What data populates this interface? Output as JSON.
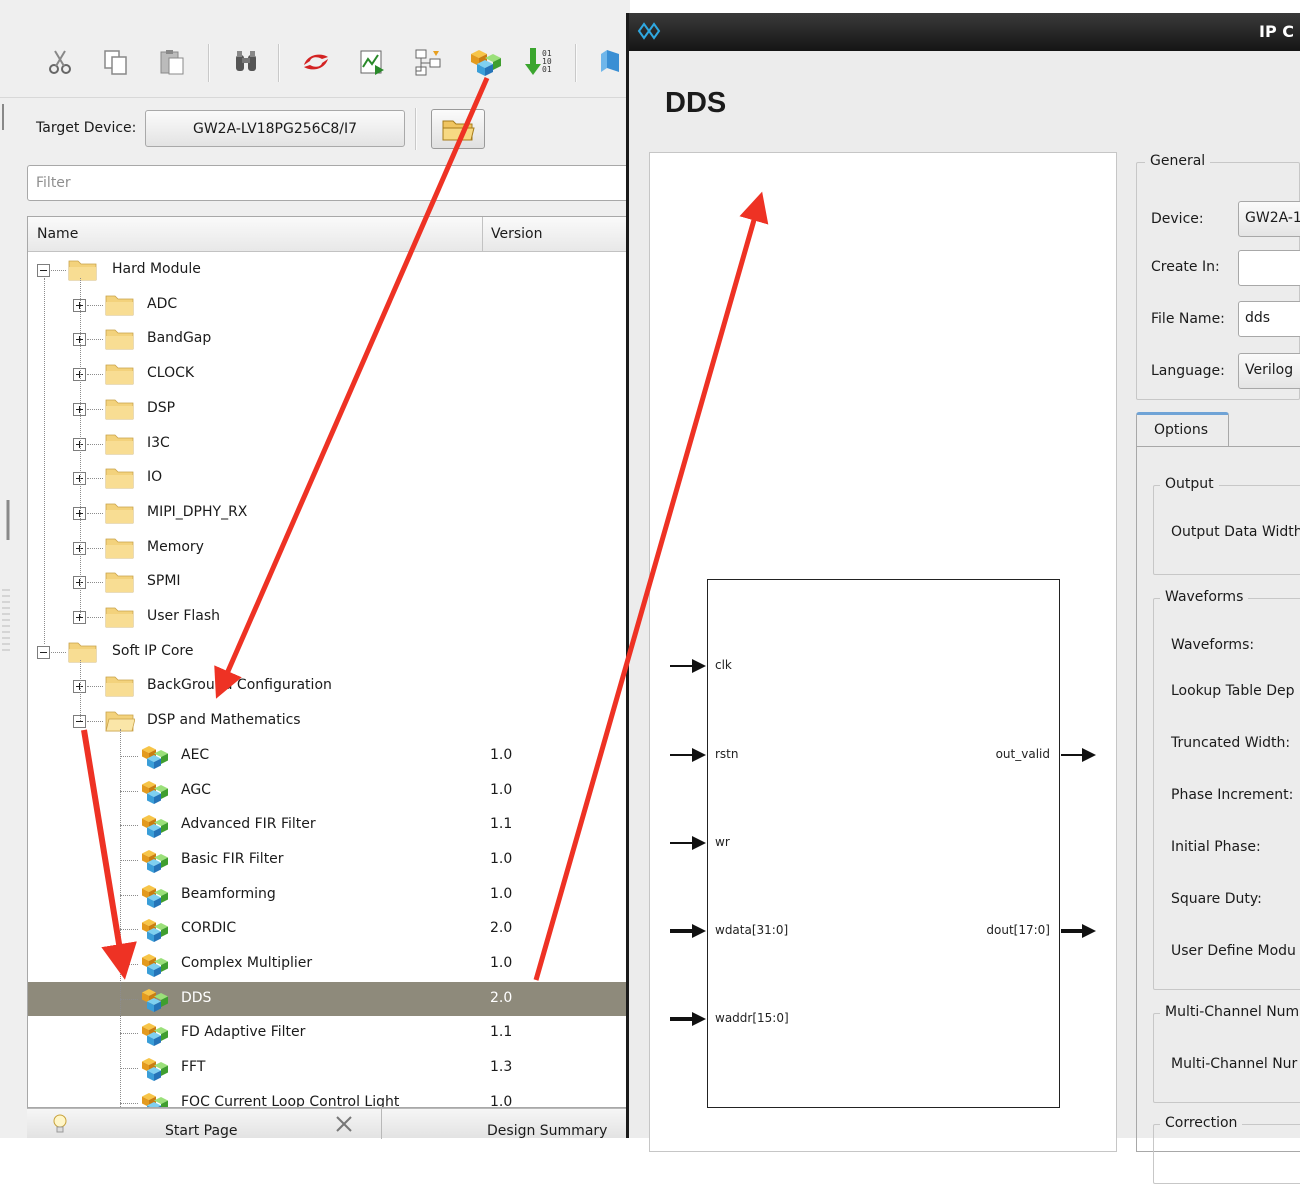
{
  "toolbar": {
    "buttons": [
      "cut-icon",
      "copy-icon",
      "paste-icon",
      "find-icon",
      "synplify-icon",
      "report-icon",
      "hierarchy-icon",
      "ip-core-icon",
      "bitstream-icon",
      "chip-icon"
    ]
  },
  "target": {
    "label": "Target Device:",
    "value": "GW2A-LV18PG256C8/I7"
  },
  "filter": {
    "placeholder": "Filter"
  },
  "tree": {
    "columns": {
      "name": "Name",
      "version": "Version"
    },
    "rows": [
      {
        "label": "Hard Module",
        "version": "",
        "level": 0,
        "kind": "folder",
        "expander": "minus"
      },
      {
        "label": "ADC",
        "version": "",
        "level": 1,
        "kind": "folder",
        "expander": "plus"
      },
      {
        "label": "BandGap",
        "version": "",
        "level": 1,
        "kind": "folder",
        "expander": "plus"
      },
      {
        "label": "CLOCK",
        "version": "",
        "level": 1,
        "kind": "folder",
        "expander": "plus"
      },
      {
        "label": "DSP",
        "version": "",
        "level": 1,
        "kind": "folder",
        "expander": "plus"
      },
      {
        "label": "I3C",
        "version": "",
        "level": 1,
        "kind": "folder",
        "expander": "plus"
      },
      {
        "label": "IO",
        "version": "",
        "level": 1,
        "kind": "folder",
        "expander": "plus"
      },
      {
        "label": "MIPI_DPHY_RX",
        "version": "",
        "level": 1,
        "kind": "folder",
        "expander": "plus"
      },
      {
        "label": "Memory",
        "version": "",
        "level": 1,
        "kind": "folder",
        "expander": "plus"
      },
      {
        "label": "SPMI",
        "version": "",
        "level": 1,
        "kind": "folder",
        "expander": "plus"
      },
      {
        "label": "User Flash",
        "version": "",
        "level": 1,
        "kind": "folder",
        "expander": "plus"
      },
      {
        "label": "Soft IP Core",
        "version": "",
        "level": 0,
        "kind": "folder",
        "expander": "minus"
      },
      {
        "label": "BackGround Configuration",
        "version": "",
        "level": 1,
        "kind": "folder",
        "expander": "plus"
      },
      {
        "label": "DSP and Mathematics",
        "version": "",
        "level": 1,
        "kind": "folder-open",
        "expander": "minus"
      },
      {
        "label": "AEC",
        "version": "1.0",
        "level": 2,
        "kind": "ip"
      },
      {
        "label": "AGC",
        "version": "1.0",
        "level": 2,
        "kind": "ip"
      },
      {
        "label": "Advanced FIR Filter",
        "version": "1.1",
        "level": 2,
        "kind": "ip"
      },
      {
        "label": "Basic FIR Filter",
        "version": "1.0",
        "level": 2,
        "kind": "ip"
      },
      {
        "label": "Beamforming",
        "version": "1.0",
        "level": 2,
        "kind": "ip"
      },
      {
        "label": "CORDIC",
        "version": "2.0",
        "level": 2,
        "kind": "ip"
      },
      {
        "label": "Complex Multiplier",
        "version": "1.0",
        "level": 2,
        "kind": "ip"
      },
      {
        "label": "DDS",
        "version": "2.0",
        "level": 2,
        "kind": "ip",
        "selected": true
      },
      {
        "label": "FD Adaptive Filter",
        "version": "1.1",
        "level": 2,
        "kind": "ip"
      },
      {
        "label": "FFT",
        "version": "1.3",
        "level": 2,
        "kind": "ip"
      },
      {
        "label": "FOC Current Loop Control Light",
        "version": "1.0",
        "level": 2,
        "kind": "ip"
      }
    ]
  },
  "bottom_tabs": {
    "start": "Start Page",
    "summary": "Design Summary"
  },
  "dialog": {
    "window_title": "IP C",
    "title": "DDS",
    "module": {
      "inputs": [
        "clk",
        "rstn",
        "wr",
        "wdata[31:0]",
        "waddr[15:0]"
      ],
      "outputs": [
        "out_valid",
        "dout[17:0]"
      ]
    },
    "general": {
      "title": "General",
      "device_label": "Device:",
      "device_value": "GW2A-1",
      "create_in_label": "Create In:",
      "create_in_value": "",
      "file_name_label": "File Name:",
      "file_name_value": "dds",
      "language_label": "Language:",
      "language_value": "Verilog"
    },
    "options_tab": "Options",
    "output_group": {
      "title": "Output",
      "field": "Output Data Width"
    },
    "waveforms_group": {
      "title": "Waveforms",
      "fields": [
        "Waveforms:",
        "Lookup Table Dep",
        "Truncated Width:",
        "Phase Increment:",
        "Initial Phase:",
        "Square Duty:",
        "User Define Modu"
      ]
    },
    "multichannel_group": {
      "title": "Multi-Channel Num",
      "field": "Multi-Channel Nur"
    },
    "correction_group": {
      "title": "Correction"
    }
  },
  "colors": {
    "selection": "#8e8a7b",
    "annotation": "#ee3224",
    "titlebar": "#1a1a1a",
    "tab_accent": "#6fa3d6"
  }
}
